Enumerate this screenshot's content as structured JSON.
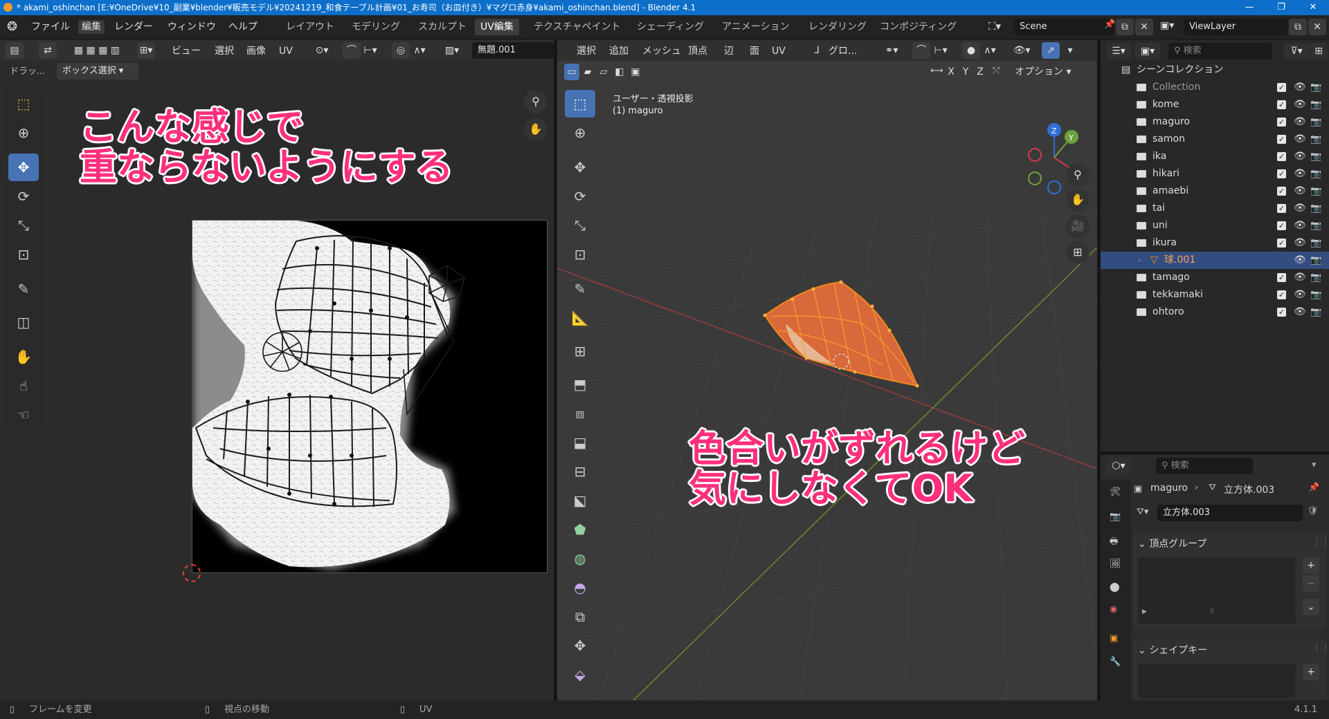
{
  "title_bar": {
    "text": "* akami_oshinchan [E:¥OneDrive¥10_副業¥blender¥販売モデル¥20241219_和食テーブル計画¥01_お寿司（お皿付き）¥マグロ赤身¥akami_oshinchan.blend] - Blender 4.1",
    "minimize": "—",
    "maximize": "❐",
    "close": "✕"
  },
  "menu": [
    "ファイル",
    "編集",
    "レンダー",
    "ウィンドウ",
    "ヘルプ"
  ],
  "workspaces": [
    "レイアウト",
    "モデリング",
    "スカルプト",
    "UV編集",
    "テクスチャペイント",
    "シェーディング",
    "アニメーション",
    "レンダリング",
    "コンポジティング"
  ],
  "active_workspace": "UV編集",
  "scene": {
    "label": "Scene",
    "view_layer": "ViewLayer"
  },
  "uv_editor": {
    "header_menus": [
      "ビュー",
      "選択",
      "画像",
      "UV"
    ],
    "image_name": "無題.001",
    "drag_label": "ドラッ...",
    "drag_mode": "ボックス選択"
  },
  "viewport": {
    "header_menus": [
      "選択",
      "追加",
      "メッシュ",
      "頂点",
      "辺",
      "面",
      "UV"
    ],
    "transform_orientation": "グロ...",
    "axes": [
      "X",
      "Y",
      "Z"
    ],
    "options_label": "オプション",
    "view_name": "ユーザー・透視投影",
    "object_name": "(1) maguro"
  },
  "annotations": {
    "uv_note_line1": "こんな感じで",
    "uv_note_line2": "重ならないようにする",
    "vp_note_line1": "色合いがずれるけど",
    "vp_note_line2": "気にしなくてOK"
  },
  "outliner": {
    "search_placeholder": "検索",
    "root": "シーンコレクション",
    "items": [
      {
        "name": "Collection",
        "muted": true
      },
      {
        "name": "kome"
      },
      {
        "name": "maguro"
      },
      {
        "name": "samon"
      },
      {
        "name": "ika"
      },
      {
        "name": "hikari"
      },
      {
        "name": "amaebi"
      },
      {
        "name": "tai"
      },
      {
        "name": "uni"
      },
      {
        "name": "ikura"
      },
      {
        "name": "球.001",
        "selected": true
      },
      {
        "name": "tamago"
      },
      {
        "name": "tekkamaki"
      },
      {
        "name": "ohtoro"
      }
    ]
  },
  "properties": {
    "search_placeholder": "検索",
    "breadcrumb_object": "maguro",
    "breadcrumb_mesh": "立方体.003",
    "mesh_name": "立方体.003",
    "vertex_groups": "頂点グループ",
    "shape_keys": "シェイプキー"
  },
  "status_bar": {
    "items": [
      "フレームを変更",
      "視点の移動",
      "UV"
    ],
    "version": "4.1.1"
  },
  "colors": {
    "accent_blue": "#4772b3",
    "annotation_pink": "#ff2f7d",
    "mesh_orange": "#f08a1c",
    "titlebar_blue": "#0d6fc9"
  }
}
